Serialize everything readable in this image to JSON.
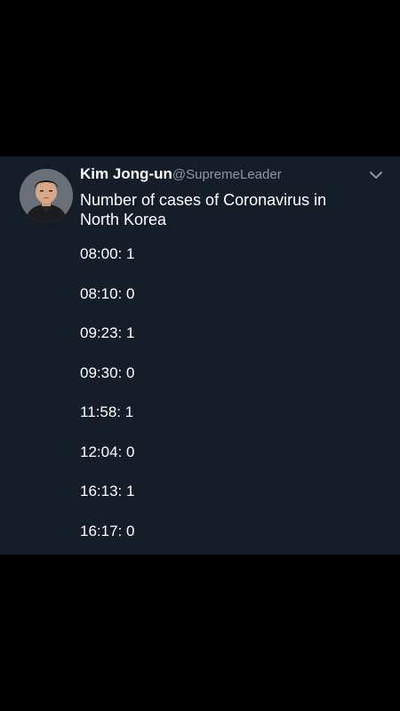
{
  "tweet": {
    "author_name": "Kim Jong-un",
    "author_handle": "@SupremeLeader",
    "text": "Number of cases of Coronavirus in North Korea",
    "entries": [
      "08:00: 1",
      "08:10: 0",
      "09:23: 1",
      "09:30: 0",
      "11:58: 1",
      "12:04: 0",
      "16:13: 1",
      "16:17: 0"
    ],
    "menu_icon": "chevron-down-icon",
    "avatar_icon": "avatar"
  },
  "colors": {
    "page_background": "#000000",
    "tweet_background": "#151d29",
    "text_primary": "#ffffff",
    "text_secondary": "#8899a6"
  }
}
